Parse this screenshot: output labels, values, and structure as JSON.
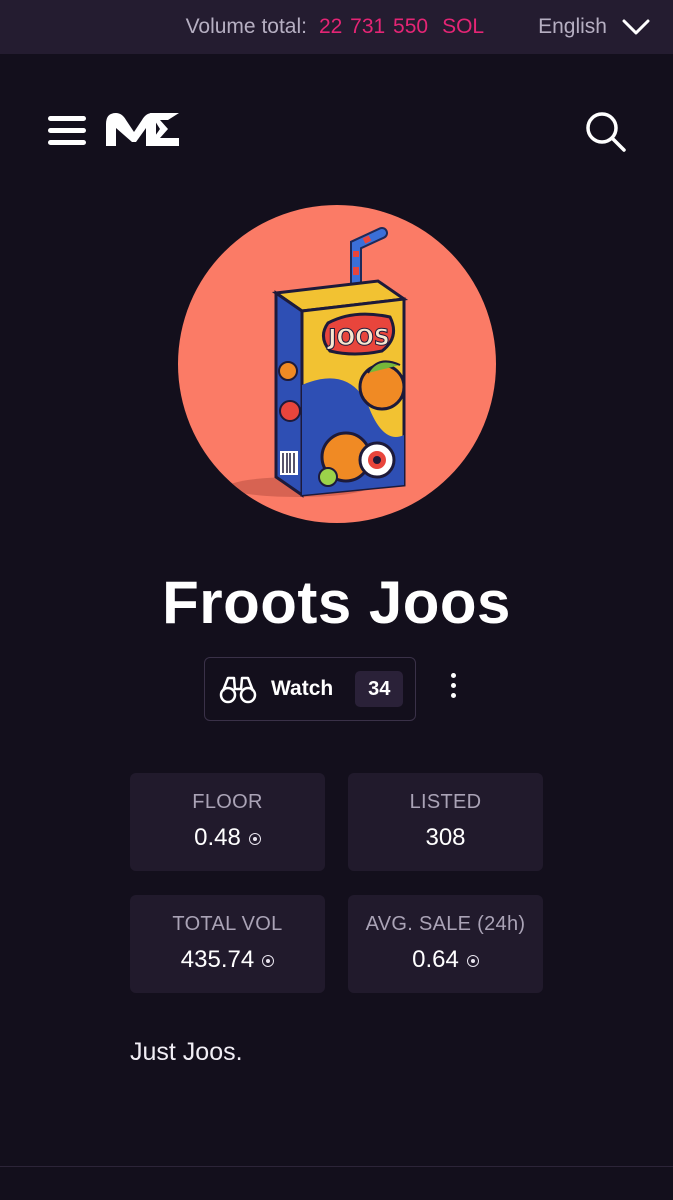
{
  "topbar": {
    "volume_label": "Volume total:",
    "volume_value": "22 731 550",
    "volume_unit": "SOL",
    "language": "English"
  },
  "header": {
    "menu_icon": "hamburger-icon",
    "logo_icon": "magic-eden-logo",
    "search_icon": "search-icon"
  },
  "collection": {
    "name": "Froots Joos",
    "carton_text": "JOOS",
    "watch_label": "Watch",
    "watch_count": "34",
    "description": "Just Joos."
  },
  "stats": [
    {
      "label": "FLOOR",
      "value": "0.48",
      "currency": true
    },
    {
      "label": "LISTED",
      "value": "308",
      "currency": false
    },
    {
      "label": "TOTAL VOL",
      "value": "435.74",
      "currency": true
    },
    {
      "label": "AVG. SALE (24h)",
      "value": "0.64",
      "currency": true
    }
  ],
  "colors": {
    "background": "#130f1c",
    "topbar": "#241c30",
    "accent_pink": "#e42575",
    "avatar_bg": "#fb7b66",
    "card_bg": "#211a2c"
  }
}
